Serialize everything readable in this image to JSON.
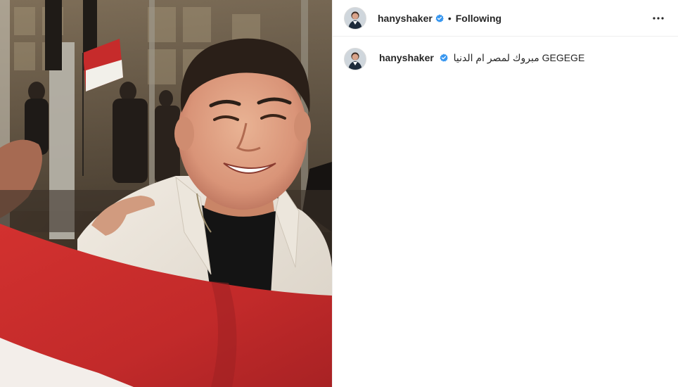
{
  "post": {
    "image_alt": "hanyshaker photo",
    "author": {
      "username": "hanyshaker",
      "verified": true,
      "avatar_icon": "profile-avatar",
      "follow_status": "Following",
      "separator": "•"
    },
    "more_icon": "more-options-icon",
    "caption": {
      "username": "hanyshaker",
      "text": "مبروك لمصر ام الدنيا GEGEGE"
    }
  },
  "colors": {
    "verified_blue": "#3897f0",
    "flag_red": "#c8282b",
    "text": "#262626"
  }
}
